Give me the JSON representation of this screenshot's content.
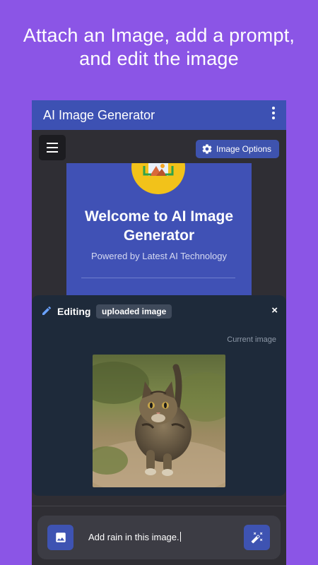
{
  "promo": {
    "line1": "Attach an Image, add a prompt,",
    "line2": "and edit the image"
  },
  "appbar": {
    "title": "AI Image Generator",
    "menu_icon": "more-vert-icon"
  },
  "toolbar": {
    "menu_icon": "hamburger-menu-icon",
    "options_label": "Image Options",
    "options_icon": "gear-icon"
  },
  "welcome": {
    "title": "Welcome to AI Image Generator",
    "subtitle": "Powered by Latest AI Technology",
    "logo_icon": "image-frame-icon"
  },
  "edit_panel": {
    "heading": "Editing",
    "badge": "uploaded image",
    "close": "×",
    "current_label": "Current image",
    "photo_subject": "tabby cat running on a dirt path"
  },
  "input": {
    "prompt_value": "Add rain in this image.",
    "attach_icon": "image-icon",
    "send_icon": "magic-wand-icon"
  },
  "colors": {
    "background": "#8b55e6",
    "appbar": "#3d51b3",
    "accent": "#3e53b2",
    "panel": "#1e2a3a",
    "logo": "#f2c21a"
  }
}
